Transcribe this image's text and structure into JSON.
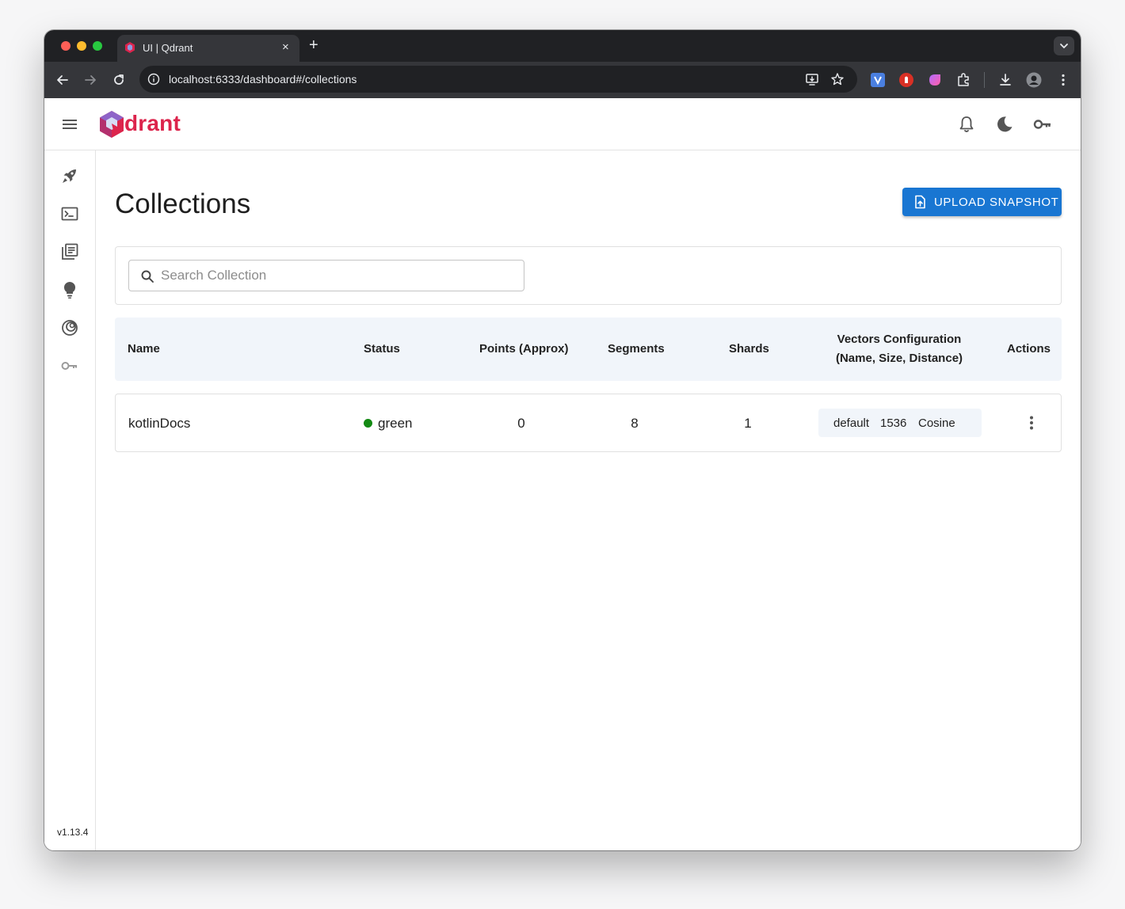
{
  "browser": {
    "tab_title": "UI | Qdrant",
    "tab_close": "×",
    "new_tab": "+",
    "url": "localhost:6333/dashboard#/collections"
  },
  "app": {
    "brand": "drant",
    "version": "v1.13.4",
    "accent_color": "#1976d2",
    "brand_color": "#dc244c"
  },
  "sidebar": {
    "items": [
      {
        "icon": "rocket-icon"
      },
      {
        "icon": "console-icon"
      },
      {
        "icon": "collections-icon"
      },
      {
        "icon": "lightbulb-icon"
      },
      {
        "icon": "datasets-icon"
      },
      {
        "icon": "key-icon"
      }
    ]
  },
  "page": {
    "title": "Collections",
    "upload_label": "UPLOAD SNAPSHOT",
    "search_placeholder": "Search Collection"
  },
  "table": {
    "headers": {
      "name": "Name",
      "status": "Status",
      "points": "Points (Approx)",
      "segments": "Segments",
      "shards": "Shards",
      "vectors_line1": "Vectors Configuration",
      "vectors_line2": "(Name, Size, Distance)",
      "actions": "Actions"
    },
    "rows": [
      {
        "name": "kotlinDocs",
        "status": "green",
        "status_color": "#138a13",
        "points": "0",
        "segments": "8",
        "shards": "1",
        "vector_name": "default",
        "vector_size": "1536",
        "vector_distance": "Cosine"
      }
    ]
  }
}
